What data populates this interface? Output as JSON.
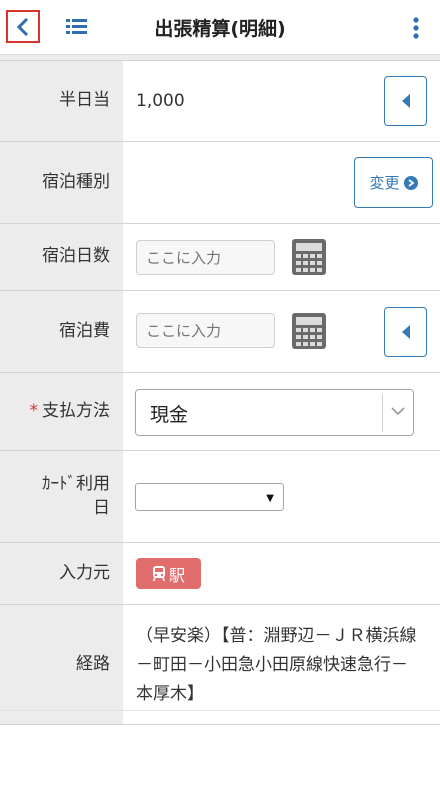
{
  "header": {
    "title": "出張精算(明細)",
    "back_icon": "chevron-left-icon",
    "list_icon": "list-icon",
    "menu_icon": "kebab-menu-icon"
  },
  "colors": {
    "accent": "#337ab7",
    "required": "#d9342b",
    "badge": "#e06c6c",
    "label_bg": "#ececec"
  },
  "fields": {
    "half_day": {
      "label": "半日当",
      "value": "1,000"
    },
    "lodging_type": {
      "label": "宿泊種別",
      "change_label": "変更"
    },
    "lodging_days": {
      "label": "宿泊日数",
      "placeholder": "ここに入力"
    },
    "lodging_cost": {
      "label": "宿泊費",
      "placeholder": "ここに入力"
    },
    "payment_method": {
      "required_mark": "*",
      "label": "支払方法",
      "value": "現金"
    },
    "card_date": {
      "label_line1": "ｶｰﾄﾞ利用",
      "label_line2": "日",
      "value": ""
    },
    "input_source": {
      "label": "入力元",
      "badge_text": "駅"
    },
    "route": {
      "label": "経路",
      "value": "（早安楽）【普：淵野辺－ＪＲ横浜線－町田－小田急小田原線快速急行－本厚木】"
    }
  }
}
